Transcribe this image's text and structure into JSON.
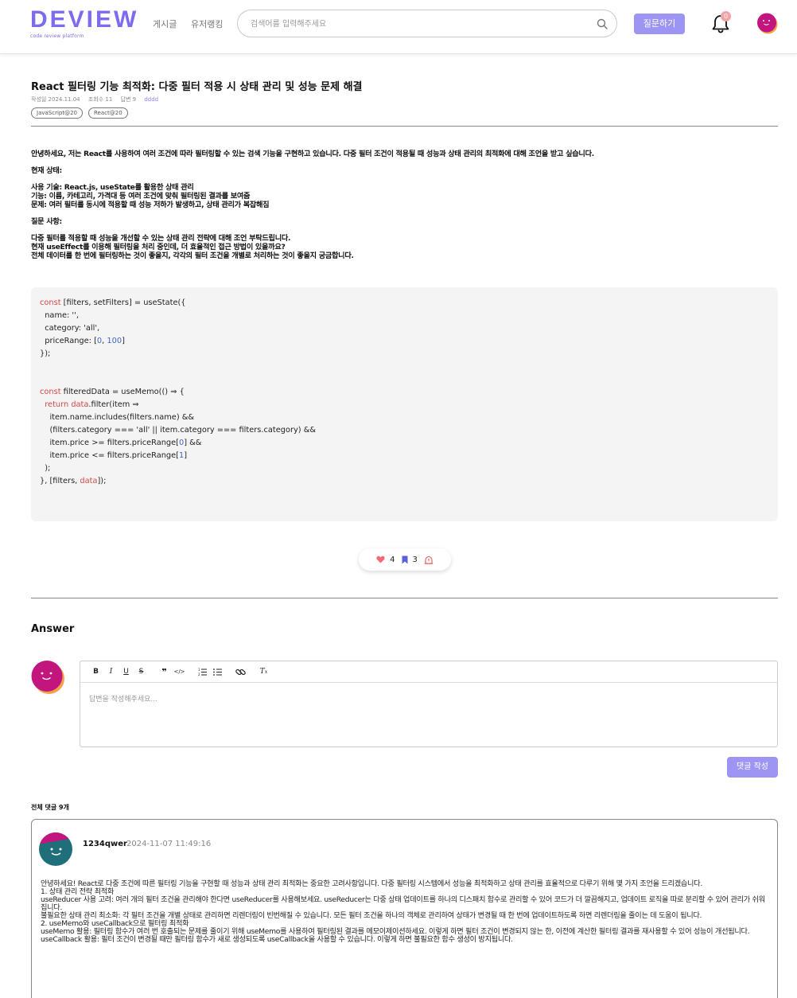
{
  "header": {
    "logo": "DEVIEW",
    "logo_sub": "code review platform",
    "nav_posts": "게시글",
    "nav_ranking": "유저랭킹",
    "search_placeholder": "검색어를 입력해주세요",
    "ask_button": "질문하기",
    "notification_count": "0"
  },
  "post": {
    "title": "React 필터링 기능 최적화: 다중 필터 적용 시 상태 관리 및 성능 문제 해결",
    "meta_date": "작성일 2024.11.04",
    "meta_views": "조회수 11",
    "meta_answers": "답변 9",
    "meta_author": "dddd",
    "tags": [
      "JavaScript@20",
      "React@20"
    ],
    "body": [
      "안녕하세요, 저는 React를 사용하여 여러 조건에 따라 필터링할 수 있는 검색 기능을 구현하고 있습니다. 다중 필터 조건이 적용될 때 성능과 상태 관리의 최적화에 대해 조언을 받고 싶습니다.",
      "현재 상태:",
      "사용 기술: React.js, useState를 활용한 상태 관리",
      "기능: 이름, 카테고리, 가격대 등 여러 조건에 맞춰 필터링된 결과를 보여줌",
      "문제: 여러 필터를 동시에 적용할 때 성능 저하가 발생하고, 상태 관리가 복잡해짐",
      "질문 사항:",
      "다중 필터를 적용할 때 성능을 개선할 수 있는 상태 관리 전략에 대해 조언 부탁드립니다.",
      "현재 useEffect를 이용해 필터링을 처리 중인데, 더 효율적인 접근 방법이 있을까요?",
      "전체 데이터를 한 번에 필터링하는 것이 좋을지, 각각의 필터 조건을 개별로 처리하는 것이 좋을지 궁금합니다."
    ],
    "likes": "4",
    "bookmarks": "3"
  },
  "answer": {
    "title": "Answer",
    "placeholder": "답변을 작성해주세요...",
    "submit": "댓글 작성"
  },
  "comments": {
    "count_label": "전체 댓글 9개",
    "items": [
      {
        "user": "1234qwer",
        "date": "2024-11-07 11:49:16",
        "lines": [
          "안녕하세요! React로 다중 조건에 따른 필터링 기능을 구현할 때 성능과 상태 관리 최적화는 중요한 고려사항입니다. 다중 필터링 시스템에서 성능을 최적화하고 상태 관리를 효율적으로 다루기 위해 몇 가지 조언을 드리겠습니다.",
          "1. 상태 관리 전략 최적화",
          "useReducer 사용 고려: 여러 개의 필터 조건을 관리해야 한다면 useReducer를 사용해보세요. useReducer는 다중 상태 업데이트를 하나의 디스패치 함수로 관리할 수 있어 코드가 더 깔끔해지고, 업데이트 로직을 따로 분리할 수 있어 관리가 쉬워집니다.",
          "불필요한 상태 관리 최소화: 각 필터 조건을 개별 상태로 관리하면 리렌더링이 빈번해질 수 있습니다. 모든 필터 조건을 하나의 객체로 관리하여 상태가 변경될 때 한 번에 업데이트하도록 하면 리렌더링을 줄이는 데 도움이 됩니다.",
          "2. useMemo와 useCallback으로 필터링 최적화",
          "useMemo 활용: 필터링 함수가 여러 번 호출되는 문제를 줄이기 위해 useMemo를 사용하여 필터링된 결과를 메모이제이션하세요. 이렇게 하면 필터 조건이 변경되지 않는 한, 이전에 계산한 필터링 결과를 재사용할 수 있어 성능이 개선됩니다.",
          "useCallback 활용: 필터 조건이 변경될 때만 필터링 함수가 새로 생성되도록 useCallback을 사용할 수 있습니다. 이렇게 하면 불필요한 함수 생성이 방지됩니다."
        ]
      }
    ]
  },
  "colors": {
    "accent": "#7b6cf0",
    "button": "#9d95f3",
    "heart": "#f06a7a",
    "bookmark": "#5b5fe0",
    "keyword": "#d04a4a",
    "number": "#3f67c6"
  }
}
